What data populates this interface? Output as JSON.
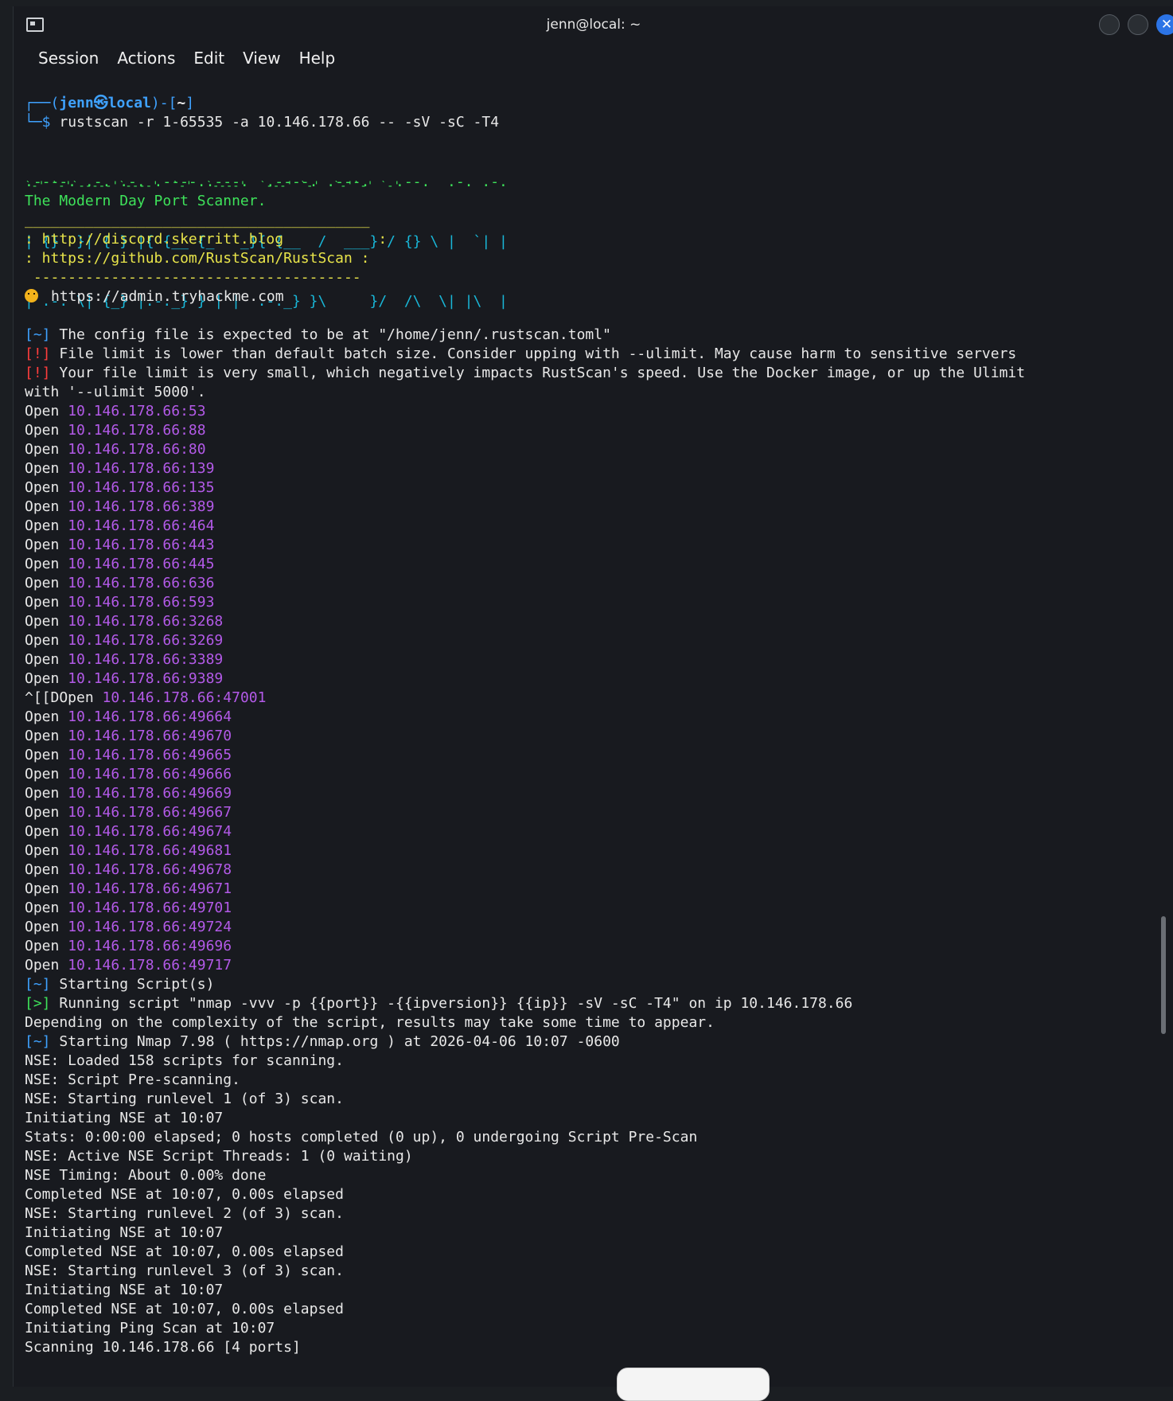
{
  "window": {
    "title": "jenn@local: ~"
  },
  "menu": [
    "Session",
    "Actions",
    "Edit",
    "View",
    "Help"
  ],
  "prompt": {
    "line1_open": "┌──(",
    "user": "jenn㉿local",
    "line1_close": ")-[",
    "dir": "~",
    "line1_end": "]",
    "line2_prefix": "└─$ ",
    "command": "rustscan -r 1-65535 -a 10.146.178.66 -- -sV -sC -T4"
  },
  "banner": {
    "line1": ".----. .-. .-. .----..---.  .----. .---.   .--.  .-. .-.",
    "line2": "| {}  }| { } |{ {__ {_   _}{ {__  /  ___} / {} \\ |  `| |",
    "line3": "| .-. \\| {_} |.-._} } | |  .-._} }\\     }/  /\\  \\| |\\  |",
    "line4": "`-' `-'`-----'`----'  `-'  `----'  `---' `-'  `-'`-' `-'",
    "tagline": "The Modern Day Port Scanner.",
    "rule_top": "________________________________________",
    "link1": ": http://discord.skerritt.blog           :",
    "link2": ": https://github.com/RustScan/RustScan :",
    "rule_bottom": " --------------------------------------",
    "admin": "https://admin.tryhackme.com"
  },
  "notices": [
    {
      "tag": "[~]",
      "text": " The config file is expected to be at \"/home/jenn/.rustscan.toml\"",
      "tag_color": "#3fa2ff"
    },
    {
      "tag": "[!]",
      "text": " File limit is lower than default batch size. Consider upping with --ulimit. May cause harm to sensitive servers",
      "tag_color": "#ff3d3d"
    },
    {
      "tag": "[!]",
      "text": " Your file limit is very small, which negatively impacts RustScan's speed. Use the Docker image, or up the Ulimit",
      "tag_color": "#ff3d3d"
    }
  ],
  "notice_wrap": "with '--ulimit 5000'.",
  "open_label": "Open",
  "escape_prefix": "^[[DOpen",
  "open_ports": [
    "10.146.178.66:53",
    "10.146.178.66:88",
    "10.146.178.66:80",
    "10.146.178.66:139",
    "10.146.178.66:135",
    "10.146.178.66:389",
    "10.146.178.66:464",
    "10.146.178.66:443",
    "10.146.178.66:445",
    "10.146.178.66:636",
    "10.146.178.66:593",
    "10.146.178.66:3268",
    "10.146.178.66:3269",
    "10.146.178.66:3389",
    "10.146.178.66:9389",
    "10.146.178.66:47001",
    "10.146.178.66:49664",
    "10.146.178.66:49670",
    "10.146.178.66:49665",
    "10.146.178.66:49666",
    "10.146.178.66:49669",
    "10.146.178.66:49667",
    "10.146.178.66:49674",
    "10.146.178.66:49681",
    "10.146.178.66:49678",
    "10.146.178.66:49671",
    "10.146.178.66:49701",
    "10.146.178.66:49724",
    "10.146.178.66:49696",
    "10.146.178.66:49717"
  ],
  "escape_index": 15,
  "script_lines": [
    {
      "tag": "[~]",
      "text": " Starting Script(s)",
      "tag_color": "#3fa2ff"
    },
    {
      "tag": "[>]",
      "text": " Running script \"nmap -vvv -p {{port}} -{{ipversion}} {{ip}} -sV -sC -T4\" on ip 10.146.178.66",
      "tag_color": "#3ee25a"
    },
    {
      "tag": "",
      "text": "Depending on the complexity of the script, results may take some time to appear.",
      "tag_color": ""
    },
    {
      "tag": "[~]",
      "text": " Starting Nmap 7.98 ( https://nmap.org ) at 2026-04-06 10:07 -0600",
      "tag_color": "#3fa2ff"
    }
  ],
  "nmap_output": [
    "NSE: Loaded 158 scripts for scanning.",
    "NSE: Script Pre-scanning.",
    "NSE: Starting runlevel 1 (of 3) scan.",
    "Initiating NSE at 10:07",
    "Stats: 0:00:00 elapsed; 0 hosts completed (0 up), 0 undergoing Script Pre-Scan",
    "NSE: Active NSE Script Threads: 1 (0 waiting)",
    "NSE Timing: About 0.00% done",
    "Completed NSE at 10:07, 0.00s elapsed",
    "NSE: Starting runlevel 2 (of 3) scan.",
    "Initiating NSE at 10:07",
    "Completed NSE at 10:07, 0.00s elapsed",
    "NSE: Starting runlevel 3 (of 3) scan.",
    "Initiating NSE at 10:07",
    "Completed NSE at 10:07, 0.00s elapsed",
    "Initiating Ping Scan at 10:07",
    "Scanning 10.146.178.66 [4 ports]"
  ],
  "colors": {
    "prompt": "#3fa2ff",
    "banner": "#3ee25a",
    "banner_alt": "#19b7d8",
    "links": "#e8e44a",
    "address": "#b35ae8",
    "close": "#2c74e6"
  }
}
